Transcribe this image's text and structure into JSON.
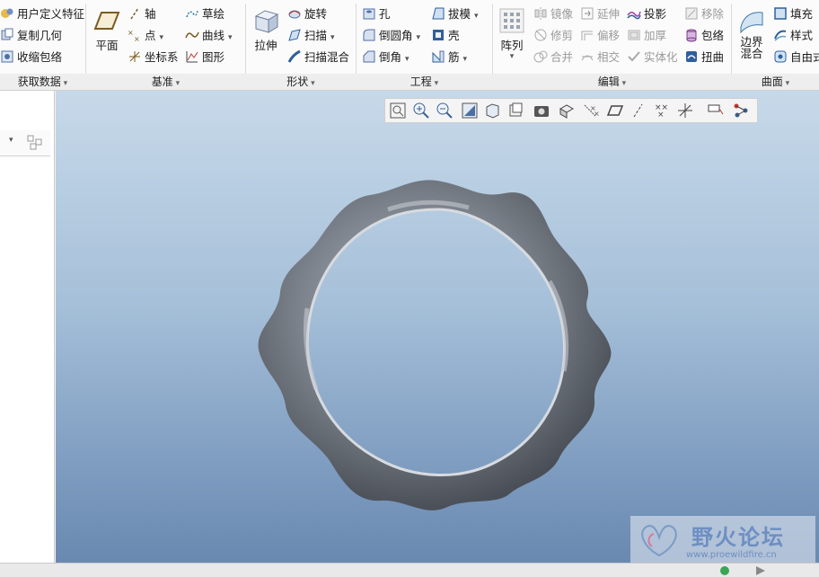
{
  "ribbon": {
    "get_data": {
      "title": "获取数据",
      "items": [
        "用户定义特征",
        "复制几何",
        "收缩包络"
      ]
    },
    "datum": {
      "title": "基准",
      "plane": "平面",
      "axis": "轴",
      "point": "点",
      "csys": "坐标系",
      "sketch": "草绘",
      "curve": "曲线",
      "graph": "图形"
    },
    "shapes": {
      "title": "形状",
      "extrude": "拉伸",
      "revolve": "旋转",
      "sweep": "扫描",
      "swept_blend": "扫描混合"
    },
    "engineering": {
      "title": "工程",
      "hole": "孔",
      "round": "倒圆角",
      "chamfer": "倒角",
      "draft": "拔模",
      "shell": "壳",
      "rib": "筋"
    },
    "editing": {
      "title": "编辑",
      "pattern": "阵列",
      "mirror": "镜像",
      "trim": "修剪",
      "merge": "合并",
      "extend": "延伸",
      "offset": "偏移",
      "intersect": "相交",
      "project": "投影",
      "thicken": "加厚",
      "solidify": "实体化",
      "remove": "移除",
      "wrap": "包络",
      "twist": "扭曲"
    },
    "surfaces": {
      "title": "曲面",
      "boundary_blend_1": "边界",
      "boundary_blend_2": "混合",
      "fill": "填充",
      "style": "样式",
      "freestyle": "自由式"
    }
  },
  "viewport": {
    "toolbar_icons": [
      "refit-icon",
      "zoom-in-icon",
      "zoom-out-icon",
      "repaint-icon",
      "named-views-icon",
      "saved-orientation-icon",
      "view-manager-icon",
      "display-style-icon",
      "datum-display-icon",
      "plane-display-icon",
      "axis-display-icon",
      "point-display-icon",
      "csys-display-icon",
      "annotation-display-icon",
      "spin-center-icon"
    ]
  },
  "watermark": {
    "title": "野火论坛",
    "url": "www.proewildfire.cn"
  },
  "colors": {
    "ribbon_bg": "#fbfbfb",
    "viewport_top": "#c7d9e9",
    "viewport_bottom": "#6a89b0",
    "model": "#7b8088"
  }
}
